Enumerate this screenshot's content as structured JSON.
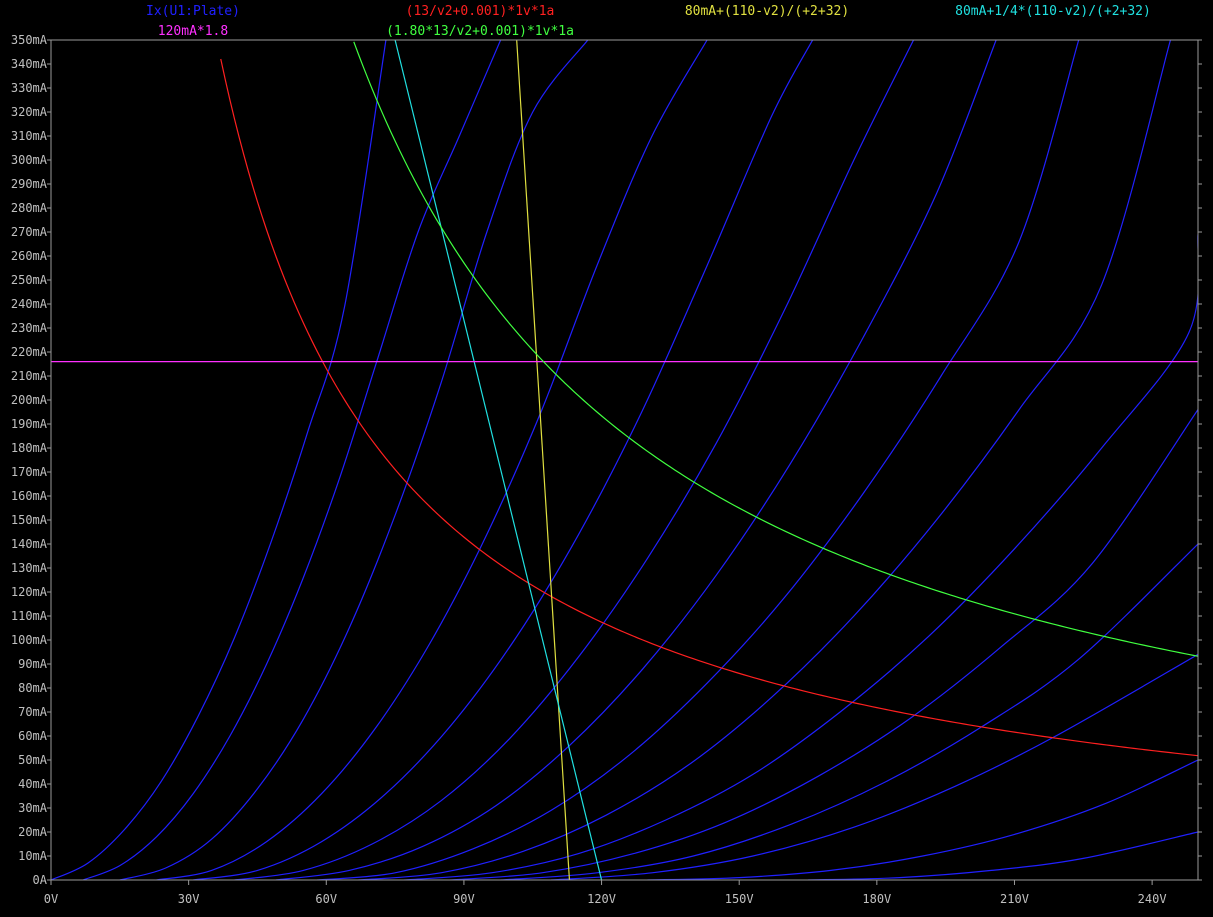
{
  "chart_data": {
    "type": "line",
    "title": "",
    "xlabel": "",
    "ylabel": "",
    "xlim": [
      0,
      250
    ],
    "ylim": [
      0,
      350
    ],
    "x_unit": "V",
    "y_unit": "mA",
    "x_ticks": [
      0,
      30,
      60,
      90,
      120,
      150,
      180,
      210,
      240
    ],
    "x_tick_labels": [
      "0V",
      "30V",
      "60V",
      "90V",
      "120V",
      "150V",
      "180V",
      "210V",
      "240V"
    ],
    "y_ticks": [
      0,
      10,
      20,
      30,
      40,
      50,
      60,
      70,
      80,
      90,
      100,
      110,
      120,
      130,
      140,
      150,
      160,
      170,
      180,
      190,
      200,
      210,
      220,
      230,
      240,
      250,
      260,
      270,
      280,
      290,
      300,
      310,
      320,
      330,
      340,
      350
    ],
    "y_tick_labels": [
      "0A",
      "10mA",
      "20mA",
      "30mA",
      "40mA",
      "50mA",
      "60mA",
      "70mA",
      "80mA",
      "90mA",
      "100mA",
      "110mA",
      "120mA",
      "130mA",
      "140mA",
      "150mA",
      "160mA",
      "170mA",
      "180mA",
      "190mA",
      "200mA",
      "210mA",
      "220mA",
      "230mA",
      "240mA",
      "250mA",
      "260mA",
      "270mA",
      "280mA",
      "290mA",
      "300mA",
      "310mA",
      "320mA",
      "330mA",
      "340mA",
      "350mA"
    ],
    "grid": false,
    "legend_placement": "top",
    "background_color": "#000000",
    "axis_color": "#9a9a9a",
    "series": [
      {
        "name": "Ix(U1:Plate)",
        "color": "#2020ff",
        "curves": [
          {
            "x": [
              0,
              8,
              16,
              24,
              32,
              40,
              48,
              56,
              64,
              73
            ],
            "y": [
              0,
              7,
              21,
              41,
              68,
              101,
              141,
              187,
              239,
              350
            ]
          },
          {
            "x": [
              7,
              15,
              23,
              31,
              39,
              47,
              55,
              63,
              71,
              80,
              89,
              98
            ],
            "y": [
              0,
              6,
              18,
              36,
              60,
              90,
              126,
              168,
              216,
              270,
              310,
              350
            ]
          },
          {
            "x": [
              15,
              25,
              35,
              45,
              55,
              65,
              75,
              85,
              95,
              105,
              117
            ],
            "y": [
              0,
              5,
              17,
              38,
              67,
              105,
              152,
              207,
              270,
              320,
              350
            ]
          },
          {
            "x": [
              23,
              35,
              47,
              59,
              71,
              83,
              95,
              107,
              119,
              131,
              143
            ],
            "y": [
              0,
              4,
              16,
              36,
              64,
              100,
              144,
              196,
              256,
              310,
              350
            ]
          },
          {
            "x": [
              31,
              45,
              59,
              73,
              87,
              101,
              115,
              129,
              143,
              157,
              166
            ],
            "y": [
              0,
              4,
              16,
              36,
              64,
              100,
              144,
              196,
              256,
              318,
              350
            ]
          },
          {
            "x": [
              40,
              55,
              70,
              85,
              100,
              115,
              130,
              145,
              160,
              175,
              188
            ],
            "y": [
              0,
              4,
              15,
              33,
              59,
              93,
              134,
              182,
              238,
              300,
              350
            ]
          },
          {
            "x": [
              49,
              65,
              81,
              97,
              113,
              129,
              145,
              161,
              177,
              193,
              206
            ],
            "y": [
              0,
              4,
              14,
              31,
              56,
              88,
              127,
              173,
              226,
              286,
              350
            ]
          },
          {
            "x": [
              58,
              75,
              92,
              109,
              126,
              143,
              160,
              177,
              194,
              211,
              224
            ],
            "y": [
              0,
              3,
              13,
              29,
              52,
              82,
              118,
              161,
              210,
              266,
              350
            ]
          },
          {
            "x": [
              67,
              85,
              103,
              121,
              139,
              157,
              175,
              193,
              211,
              229,
              244
            ],
            "y": [
              0,
              3,
              12,
              27,
              48,
              76,
              110,
              150,
              196,
              248,
              350
            ]
          },
          {
            "x": [
              77,
              96,
              115,
              134,
              153,
              172,
              191,
              210,
              229,
              248,
              250
            ],
            "y": [
              0,
              3,
              11,
              25,
              44,
              70,
              101,
              138,
              180,
              228,
              269
            ]
          },
          {
            "x": [
              87,
              107,
              127,
              147,
              167,
              187,
              207,
              227,
              250
            ],
            "y": [
              0,
              3,
              11,
              24,
              43,
              67,
              97,
              132,
              196
            ]
          },
          {
            "x": [
              98,
              119,
              140,
              161,
              182,
              203,
              224,
              250
            ],
            "y": [
              0,
              3,
              10,
              23,
              41,
              64,
              92,
              140
            ]
          },
          {
            "x": [
              109,
              131,
              153,
              175,
              197,
              219,
              250
            ],
            "y": [
              0,
              3,
              10,
              22,
              39,
              60,
              94
            ]
          },
          {
            "x": [
              130,
              150,
              170,
              190,
              210,
              230,
              250
            ],
            "y": [
              0,
              1,
              4,
              10,
              19,
              32,
              50
            ]
          },
          {
            "x": [
              165,
              185,
              205,
              225,
              250
            ],
            "y": [
              0,
              1,
              4,
              9,
              20
            ]
          }
        ]
      },
      {
        "name": "(13/v2+0.001)*1v*1a",
        "color": "#ff2020",
        "formula": "13000/(v+1)",
        "x_range": [
          37,
          250
        ]
      },
      {
        "name": "80mA+(110-v2)/(+2+32)",
        "color": "#e0e040",
        "x": [
          101.5,
          113
        ],
        "y": [
          350,
          0
        ]
      },
      {
        "name": "80mA+1/4*(110-v2)/(+2+32)",
        "color": "#20e0e0",
        "x": [
          75,
          120
        ],
        "y": [
          350,
          0
        ]
      },
      {
        "name": "120mA*1.8",
        "color": "#ff30ff",
        "x": [
          0,
          250
        ],
        "y": [
          216,
          216
        ]
      },
      {
        "name": "(1.80*13/v2+0.001)*1v*1a",
        "color": "#40ff40",
        "formula": "23400/(v+1)",
        "x_range": [
          66,
          250
        ]
      }
    ]
  }
}
